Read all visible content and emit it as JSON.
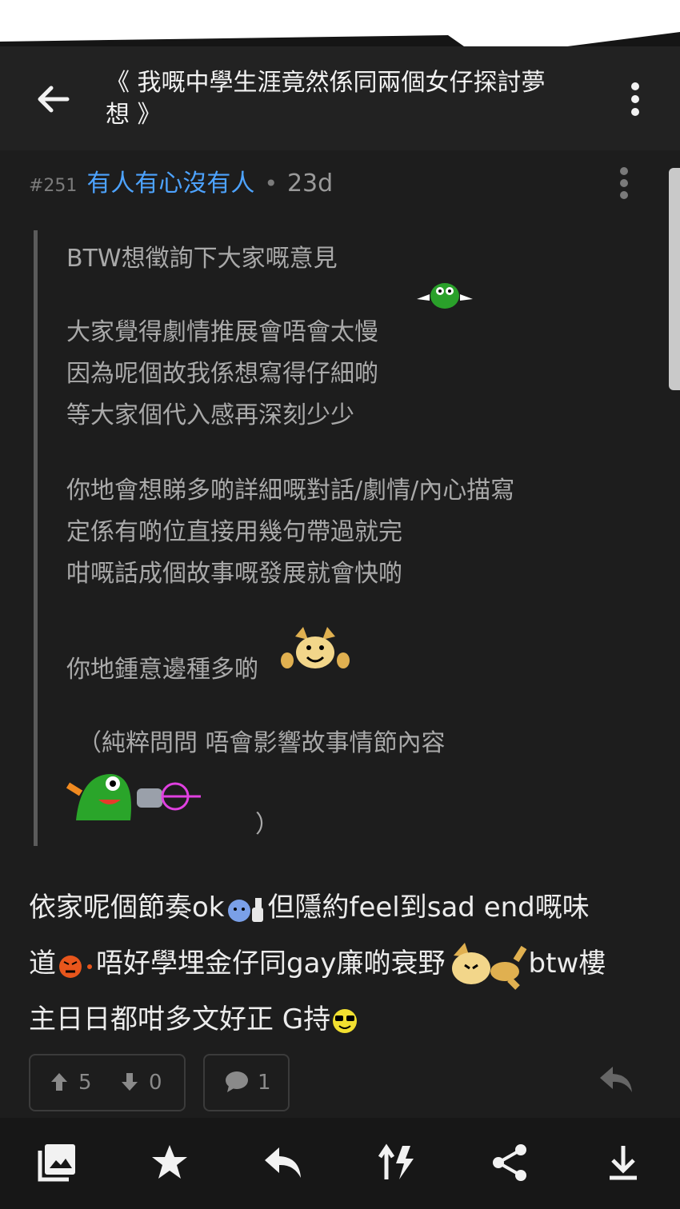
{
  "header": {
    "title": "《 我嘅中學生涯竟然係同兩個女仔探討夢想 》"
  },
  "post": {
    "number": "#251",
    "username": "有人有心沒有人",
    "separator": "•",
    "age": "23d",
    "quote_lines": [
      "BTW想徵詢下大家嘅意見",
      "大家覺得劇情推展會唔會太慢",
      "因為呢個故我係想寫得仔細啲",
      "等大家個代入感再深刻少少",
      "你地會想睇多啲詳細嘅對話/劇情/內心描寫",
      "定係有啲位直接用幾句帶過就完",
      "咁嘅話成個故事嘅發展就會快啲",
      "你地鍾意邊種多啲",
      "（純粹問問 唔會影響故事情節內容",
      "）"
    ],
    "reply": {
      "line1_a": "依家呢個節奏ok",
      "line1_b": "但隱約feel到sad end嘅味",
      "line2_a": "道",
      "line2_b": "唔好學埋金仔同gay廉啲衰野",
      "line2_c": "btw樓",
      "line3_a": "主日日都咁多文好正 G持"
    },
    "upvotes": "5",
    "downvotes": "0",
    "comments": "1"
  },
  "icons": {
    "back": "arrow-left-icon",
    "menu": "more-vertical-icon",
    "upvote": "arrow-up-icon",
    "downvote": "arrow-down-icon",
    "comment": "comment-icon",
    "reply": "reply-icon",
    "toolbar": [
      "gallery-icon",
      "star-icon",
      "reply-icon",
      "sort-icon",
      "share-icon",
      "download-icon"
    ]
  },
  "colors": {
    "background": "#1d1d1d",
    "topbar": "#222222",
    "username": "#4da3ff",
    "quote_text": "#a9a9a9"
  }
}
